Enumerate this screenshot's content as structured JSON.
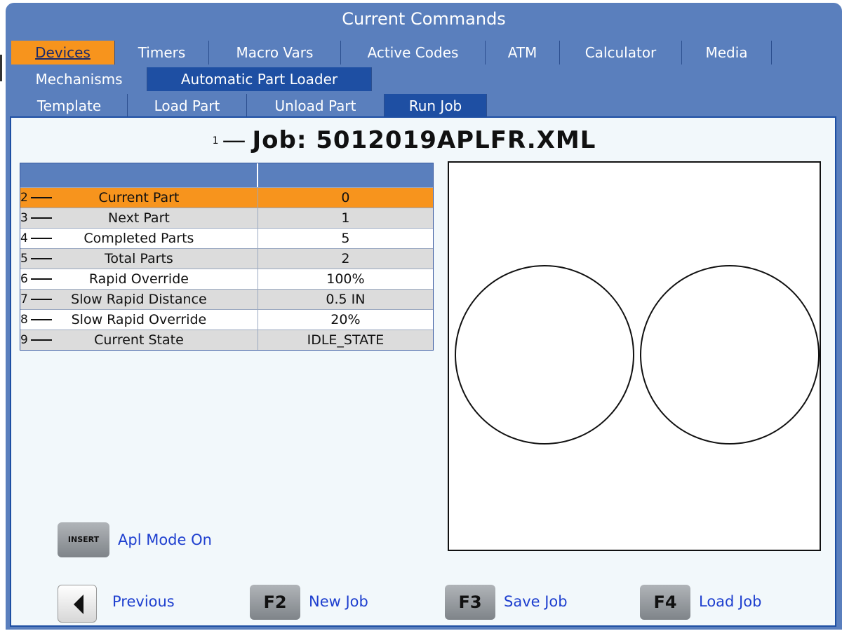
{
  "header": {
    "title": "Current Commands"
  },
  "tabs_row1": [
    {
      "label": "Devices"
    },
    {
      "label": "Timers"
    },
    {
      "label": "Macro Vars"
    },
    {
      "label": "Active Codes"
    },
    {
      "label": "ATM"
    },
    {
      "label": "Calculator"
    },
    {
      "label": "Media"
    }
  ],
  "tabs_row2": [
    {
      "label": "Mechanisms"
    },
    {
      "label": "Automatic Part Loader"
    }
  ],
  "tabs_row3": [
    {
      "label": "Template"
    },
    {
      "label": "Load Part"
    },
    {
      "label": "Unload Part"
    },
    {
      "label": "Run Job"
    }
  ],
  "job": {
    "callout": "1",
    "title": "Job: 5012019APLFR.XML"
  },
  "table": {
    "rows": [
      {
        "callout": "2",
        "label": "Current Part",
        "value": "0"
      },
      {
        "callout": "3",
        "label": "Next Part",
        "value": "1"
      },
      {
        "callout": "4",
        "label": "Completed Parts",
        "value": "5"
      },
      {
        "callout": "5",
        "label": "Total Parts",
        "value": "2"
      },
      {
        "callout": "6",
        "label": "Rapid Override",
        "value": "100%"
      },
      {
        "callout": "7",
        "label": "Slow Rapid Distance",
        "value": "0.5 IN"
      },
      {
        "callout": "8",
        "label": "Slow Rapid Override",
        "value": "20%"
      },
      {
        "callout": "9",
        "label": "Current State",
        "value": "IDLE_STATE"
      }
    ]
  },
  "insert": {
    "key": "INSERT",
    "label": "Apl Mode On"
  },
  "softkeys": {
    "previous_label": "Previous",
    "f2_key": "F2",
    "f2_label": "New Job",
    "f3_key": "F3",
    "f3_label": "Save Job",
    "f4_key": "F4",
    "f4_label": "Load Job"
  },
  "colors": {
    "frame": "#5a7fbd",
    "active_tab": "#f7941d",
    "selected_blue": "#1e4fa3",
    "link": "#1e3fcf"
  }
}
